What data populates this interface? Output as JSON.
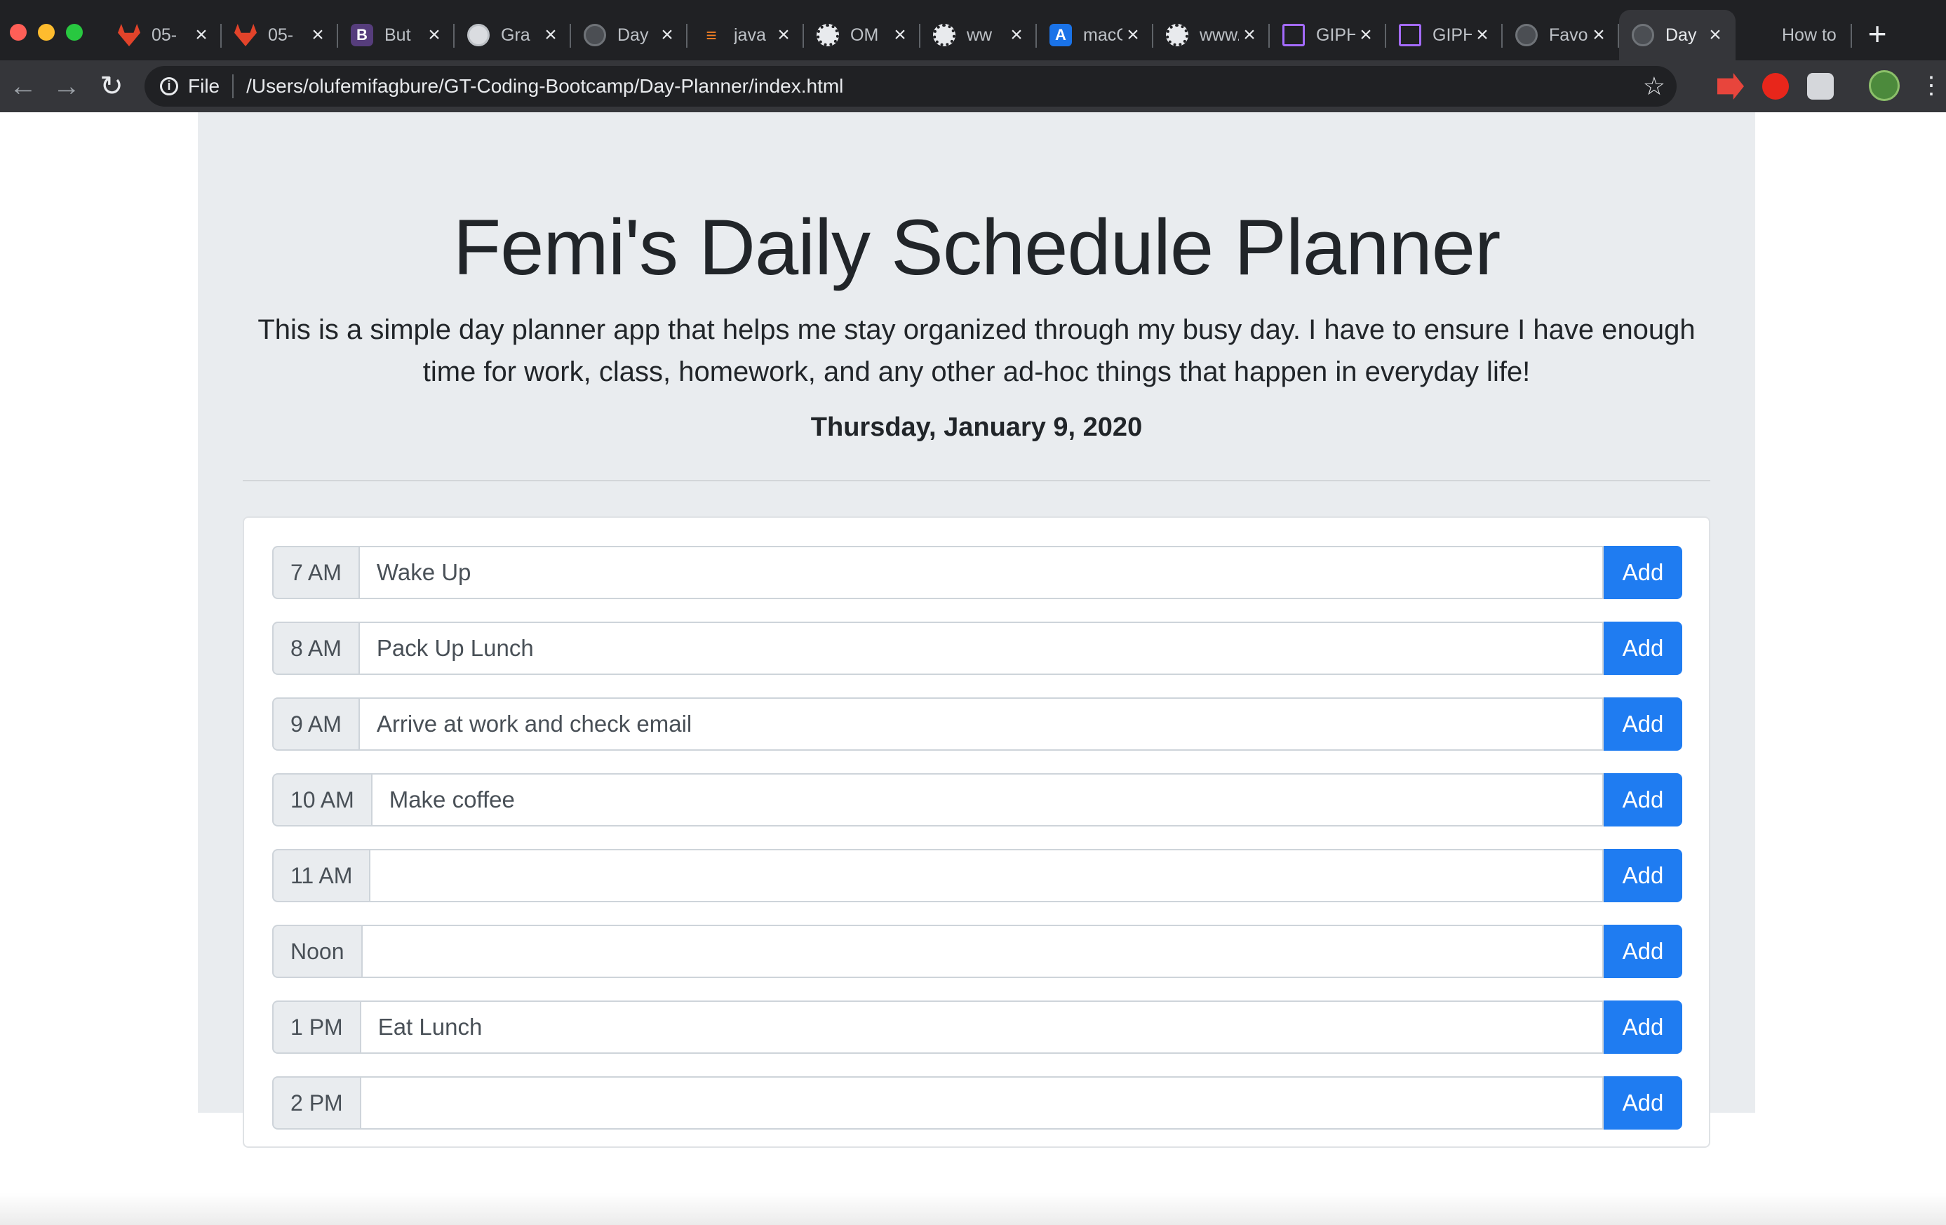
{
  "browser": {
    "tabs": [
      {
        "title": "05-",
        "icon": "gitlab-icon",
        "active": false
      },
      {
        "title": "05-",
        "icon": "gitlab-icon",
        "active": false
      },
      {
        "title": "But",
        "icon": "bootstrap-icon",
        "active": false
      },
      {
        "title": "Gra",
        "icon": "globe-icon",
        "active": false
      },
      {
        "title": "Day",
        "icon": "globe-icon",
        "active": false
      },
      {
        "title": "java",
        "icon": "stackoverflow-icon",
        "active": false
      },
      {
        "title": "OM",
        "icon": "soccer-ball-icon",
        "active": false
      },
      {
        "title": "ww",
        "icon": "soccer-ball-icon",
        "active": false
      },
      {
        "title": "macOS",
        "icon": "app-store-icon",
        "active": false
      },
      {
        "title": "www.o",
        "icon": "soccer-ball-icon",
        "active": false
      },
      {
        "title": "GIPHY",
        "icon": "giphy-icon",
        "active": false
      },
      {
        "title": "GIPHY",
        "icon": "giphy-icon",
        "active": false
      },
      {
        "title": "Favorite",
        "icon": "globe-icon",
        "active": false
      },
      {
        "title": "Day",
        "icon": "globe-icon",
        "active": true
      },
      {
        "title": "How to",
        "icon": "apple-icon",
        "active": false
      }
    ],
    "omnibox": {
      "scheme_label": "File",
      "url": "/Users/olufemifagbure/GT-Coding-Bootcamp/Day-Planner/index.html"
    }
  },
  "header": {
    "title": "Femi's Daily Schedule Planner",
    "lead": "This is a simple day planner app that helps me stay organized through my busy day. I have to ensure I have enough time for work, class, homework, and any other ad-hoc things that happen in everyday life!",
    "date": "Thursday, January 9, 2020"
  },
  "schedule": {
    "add_label": "Add",
    "rows": [
      {
        "hour": "7 AM",
        "task": "Wake Up"
      },
      {
        "hour": "8 AM",
        "task": "Pack Up Lunch"
      },
      {
        "hour": "9 AM",
        "task": "Arrive at work and check email"
      },
      {
        "hour": "10 AM",
        "task": "Make coffee"
      },
      {
        "hour": "11 AM",
        "task": ""
      },
      {
        "hour": "Noon",
        "task": ""
      },
      {
        "hour": "1 PM",
        "task": "Eat Lunch"
      },
      {
        "hour": "2 PM",
        "task": ""
      }
    ]
  },
  "colors": {
    "accent": "#1f7cf1",
    "jumbotron": "#e9ecef",
    "chrome": "#202124"
  }
}
